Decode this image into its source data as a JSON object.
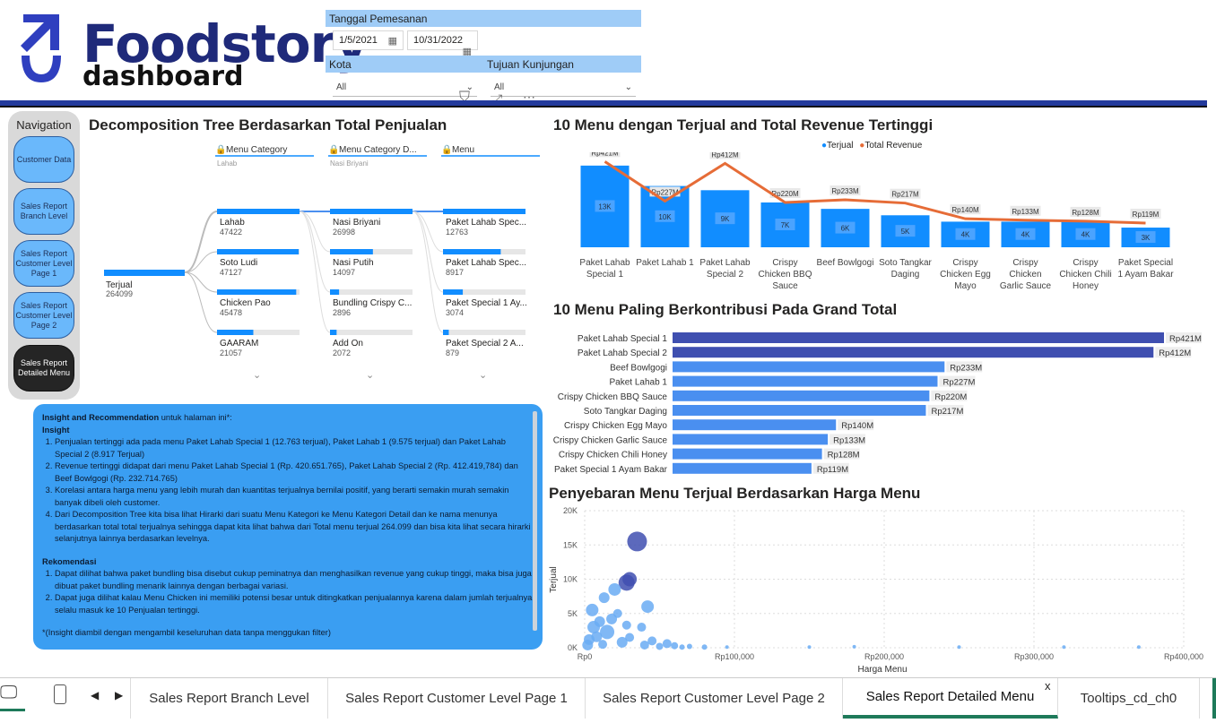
{
  "logo": {
    "title": "Foodstory",
    "subtitle": "dashboard"
  },
  "filters": {
    "date_label": "Tanggal Pemesanan",
    "date_from": "1/5/2021",
    "date_to": "10/31/2022",
    "kota_label": "Kota",
    "tujuan_label": "Tujuan Kunjungan",
    "kota_value": "All",
    "tujuan_value": "All"
  },
  "navigation": {
    "title": "Navigation",
    "items": [
      {
        "label": "Customer Data"
      },
      {
        "label": "Sales Report Branch Level"
      },
      {
        "label": "Sales Report Customer Level Page 1"
      },
      {
        "label": "Sales Report Customer Level Page 2"
      },
      {
        "label": "Sales Report Detailed Menu"
      }
    ]
  },
  "decomp": {
    "title": "Decomposition Tree Berdasarkan Total Penjualan",
    "root": {
      "label": "Terjual",
      "value": "264099"
    },
    "levels": [
      {
        "header": "Menu Category",
        "sub": "Lahab"
      },
      {
        "header": "Menu Category D...",
        "sub": "Nasi Briyani"
      },
      {
        "header": "Menu",
        "sub": ""
      }
    ],
    "col1": [
      {
        "label": "Lahab",
        "value": "47422",
        "frac": 1
      },
      {
        "label": "Soto Ludi",
        "value": "47127",
        "frac": 0.99
      },
      {
        "label": "Chicken Pao",
        "value": "45478",
        "frac": 0.96
      },
      {
        "label": "GAARAM",
        "value": "21057",
        "frac": 0.44
      }
    ],
    "col2": [
      {
        "label": "Nasi Briyani",
        "value": "26998",
        "frac": 1
      },
      {
        "label": "Nasi Putih",
        "value": "14097",
        "frac": 0.52
      },
      {
        "label": "Bundling Crispy C...",
        "value": "2896",
        "frac": 0.11
      },
      {
        "label": "Add On",
        "value": "2072",
        "frac": 0.08
      }
    ],
    "col3": [
      {
        "label": "Paket Lahab Spec...",
        "value": "12763",
        "frac": 1
      },
      {
        "label": "Paket Lahab Spec...",
        "value": "8917",
        "frac": 0.7
      },
      {
        "label": "Paket Special 1 Ay...",
        "value": "3074",
        "frac": 0.24
      },
      {
        "label": "Paket Special 2 A...",
        "value": "879",
        "frac": 0.07
      }
    ]
  },
  "insight": {
    "heading_bold": "Insight and Recommendation",
    "heading_rest": " untuk halaman ini*:",
    "insight_title": "Insight",
    "insight_items": [
      "Penjualan tertinggi ada pada menu Paket Lahab Special 1 (12.763 terjual), Paket Lahab 1 (9.575 terjual) dan Paket Lahab Special 2 (8.917 Terjual)",
      "Revenue tertinggi didapat dari menu Paket Lahab Special 1 (Rp. 420.651.765), Paket Lahab Special 2 (Rp. 412.419,784) dan Beef Bowlgogi (Rp. 232.714.765)",
      "Korelasi antara harga menu yang lebih murah dan kuantitas terjualnya bernilai positif, yang berarti semakin murah semakin banyak dibeli oleh customer.",
      "Dari Decomposition Tree kita bisa lihat Hirarki dari suatu Menu Kategori ke Menu Kategori Detail dan ke nama menunya berdasarkan total total terjualnya sehingga dapat kita lihat bahwa dari Total menu terjual 264.099 dan bisa kita lihat secara hirarki selanjutnya  lainnya berdasarkan levelnya."
    ],
    "rec_title": "Rekomendasi",
    "rec_items": [
      "Dapat dilihat bahwa paket bundling bisa disebut cukup peminatnya dan menghasilkan revenue yang cukup tinggi, maka bisa juga dibuat paket bundling menarik lainnya dengan berbagai variasi.",
      "Dapat juga dilihat kalau Menu Chicken ini memiliki potensi besar untuk ditingkatkan penjualannya karena dalam jumlah terjualnya selalu masuk ke 10 Penjualan tertinggi."
    ],
    "footnote": "*(Insight diambil dengan mengambil keseluruhan data tanpa menggukan filter)"
  },
  "colors": {
    "accent": "#118dff",
    "line": "#e66c37",
    "navy": "#3f4fb0",
    "blue_bar": "#4a8ff0"
  },
  "chart_data": [
    {
      "type": "bar",
      "title": "10 Menu dengan Terjual and Total Revenue Tertinggi",
      "legend": [
        "Terjual",
        "Total Revenue"
      ],
      "categories": [
        "Paket Lahab Special 1",
        "Paket Lahab 1",
        "Paket Lahab Special 2",
        "Crispy Chicken BBQ Sauce",
        "Beef Bowlgogi",
        "Soto Tangkar Daging",
        "Crispy Chicken Egg Mayo",
        "Crispy Chicken Garlic Sauce",
        "Crispy Chicken Chili Honey",
        "Paket Special 1 Ayam Bakar"
      ],
      "series": [
        {
          "name": "Terjual",
          "values": [
            12763,
            9575,
            8917,
            7000,
            6000,
            5000,
            4000,
            4000,
            4000,
            3074
          ],
          "labels": [
            "13K",
            "10K",
            "9K",
            "7K",
            "6K",
            "5K",
            "4K",
            "4K",
            "4K",
            "3K"
          ]
        },
        {
          "name": "Total Revenue",
          "values": [
            421,
            227,
            412,
            220,
            233,
            217,
            140,
            133,
            128,
            119
          ],
          "labels": [
            "Rp421M",
            "Rp227M",
            "Rp412M",
            "Rp220M",
            "Rp233M",
            "Rp217M",
            "Rp140M",
            "Rp133M",
            "Rp128M",
            "Rp119M"
          ]
        }
      ]
    },
    {
      "type": "bar",
      "orientation": "horizontal",
      "title": "10 Menu Paling Berkontribusi Pada Grand Total",
      "categories": [
        "Paket Lahab Special 1",
        "Paket Lahab Special 2",
        "Beef Bowlgogi",
        "Paket Lahab 1",
        "Crispy Chicken BBQ Sauce",
        "Soto Tangkar Daging",
        "Crispy Chicken Egg Mayo",
        "Crispy Chicken Garlic Sauce",
        "Crispy Chicken Chili Honey",
        "Paket Special 1 Ayam Bakar"
      ],
      "values": [
        421,
        412,
        233,
        227,
        220,
        217,
        140,
        133,
        128,
        119
      ],
      "labels": [
        "Rp421M",
        "Rp412M",
        "Rp233M",
        "Rp227M",
        "Rp220M",
        "Rp217M",
        "Rp140M",
        "Rp133M",
        "Rp128M",
        "Rp119M"
      ]
    },
    {
      "type": "scatter",
      "title": "Penyebaran Menu Terjual Berdasarkan Harga Menu",
      "xlabel": "Harga Menu",
      "ylabel": "Terjual",
      "xlim": [
        0,
        400000
      ],
      "ylim": [
        0,
        20000
      ],
      "xticks": [
        "Rp0",
        "Rp100,000",
        "Rp200,000",
        "Rp300,000",
        "Rp400,000"
      ],
      "yticks": [
        "0K",
        "5K",
        "10K",
        "15K",
        "20K"
      ],
      "points": [
        [
          35000,
          15500,
          11
        ],
        [
          30000,
          10000,
          8
        ],
        [
          28000,
          9500,
          9
        ],
        [
          20000,
          8500,
          7
        ],
        [
          13000,
          7300,
          6
        ],
        [
          42000,
          6000,
          7
        ],
        [
          5000,
          5500,
          7
        ],
        [
          22000,
          5000,
          5
        ],
        [
          10000,
          3800,
          6
        ],
        [
          18000,
          4200,
          6
        ],
        [
          28000,
          3300,
          5
        ],
        [
          38000,
          3000,
          5
        ],
        [
          6000,
          3000,
          7
        ],
        [
          15000,
          2300,
          8
        ],
        [
          8000,
          1600,
          6
        ],
        [
          30000,
          1500,
          5
        ],
        [
          45000,
          1000,
          5
        ],
        [
          55000,
          600,
          5
        ],
        [
          3000,
          1200,
          6
        ],
        [
          25000,
          800,
          6
        ],
        [
          12000,
          500,
          5
        ],
        [
          60000,
          300,
          4
        ],
        [
          70000,
          200,
          3
        ],
        [
          80000,
          100,
          3
        ],
        [
          95000,
          100,
          2
        ],
        [
          150000,
          100,
          2
        ],
        [
          180000,
          150,
          2
        ],
        [
          250000,
          100,
          2
        ],
        [
          320000,
          100,
          2
        ],
        [
          370000,
          100,
          2
        ],
        [
          2000,
          400,
          6
        ],
        [
          40000,
          400,
          5
        ],
        [
          50000,
          200,
          4
        ],
        [
          65000,
          100,
          3
        ]
      ]
    }
  ],
  "tabs": [
    "Sales Report Branch Level",
    "Sales Report Customer Level Page 1",
    "Sales Report Customer Level Page 2",
    "Sales Report Detailed Menu",
    "Tooltips_cd_ch0"
  ],
  "active_tab": "Sales Report Detailed Menu"
}
